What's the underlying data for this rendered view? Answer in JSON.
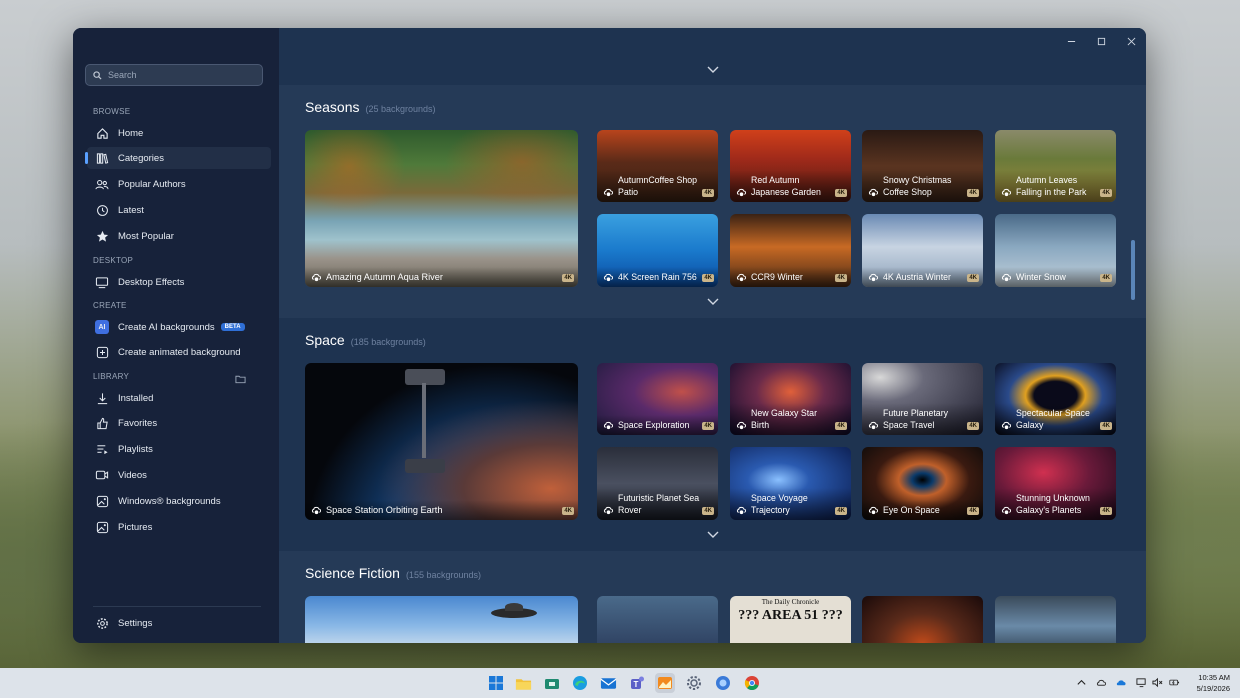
{
  "sidebar": {
    "search_placeholder": "Search",
    "browse_label": "BROWSE",
    "desktop_label": "DESKTOP",
    "create_label": "CREATE",
    "library_label": "LIBRARY",
    "beta_label": "BETA",
    "items": [
      {
        "label": "Home"
      },
      {
        "label": "Categories"
      },
      {
        "label": "Popular Authors"
      },
      {
        "label": "Latest"
      },
      {
        "label": "Most Popular"
      },
      {
        "label": "Desktop Effects"
      },
      {
        "label": "Create AI backgrounds"
      },
      {
        "label": "Create animated background"
      },
      {
        "label": "Installed"
      },
      {
        "label": "Favorites"
      },
      {
        "label": "Playlists"
      },
      {
        "label": "Videos"
      },
      {
        "label": "Windows® backgrounds"
      },
      {
        "label": "Pictures"
      },
      {
        "label": "Settings"
      }
    ]
  },
  "sections": [
    {
      "title": "Seasons",
      "count": "(25 backgrounds)",
      "featured": "Amazing Autumn Aqua River",
      "cards": [
        "AutumnCoffee Shop Patio",
        "Red Autumn Japanese Garden",
        "Snowy Christmas Coffee Shop",
        "Autumn Leaves Falling in the Park",
        "4K Screen Rain 756",
        "CCR9 Winter",
        "4K Austria Winter",
        "Winter Snow"
      ]
    },
    {
      "title": "Space",
      "count": "(185 backgrounds)",
      "featured": "Space Station Orbiting Earth",
      "cards": [
        "Space Exploration",
        "New Galaxy Star Birth",
        "Future Planetary Space Travel",
        "Spectacular Space Galaxy",
        "Futuristic Planet Sea Rover",
        "Space Voyage Trajectory",
        "Eye On Space",
        "Stunning Unknown Galaxy's Planets"
      ]
    },
    {
      "title": "Science Fiction",
      "count": "(155 backgrounds)",
      "featured": "",
      "cards": [
        "",
        "??? AREA 51 ???",
        "",
        ""
      ]
    }
  ],
  "badge_4k": "4K",
  "newspaper_header": "The Daily Chronicle",
  "clock": {
    "time": "10:35 AM",
    "date": "5/19/2026"
  },
  "colors": {
    "accent": "#5aa0ff",
    "window_bg": "#1e3350",
    "sidebar_bg": "#17223a"
  }
}
